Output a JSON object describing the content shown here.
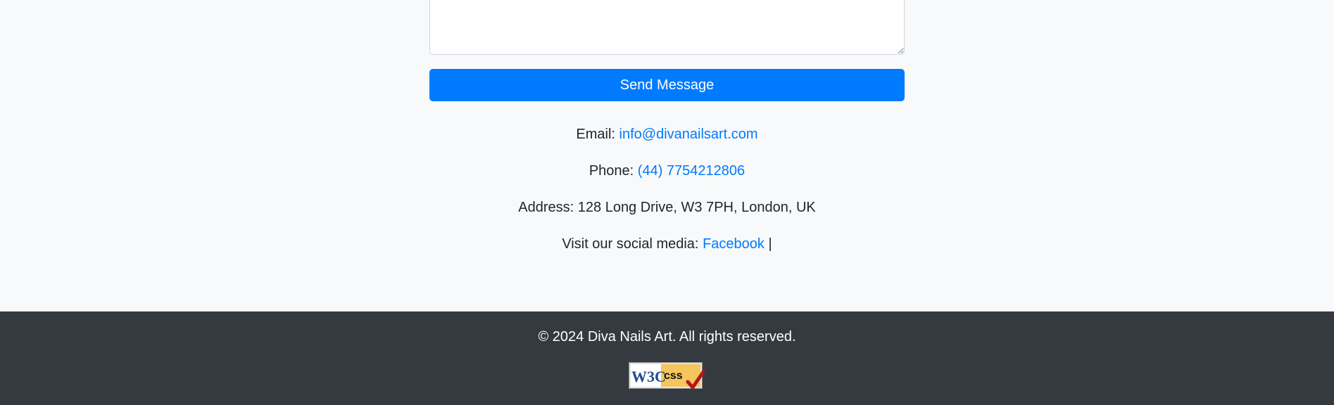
{
  "form": {
    "message_value": "",
    "send_label": "Send Message"
  },
  "contact": {
    "email_label": "Email:",
    "email_value": "info@divanailsart.com",
    "phone_label": "Phone:",
    "phone_value": "(44) 7754212806",
    "address_label": "Address:",
    "address_value": "128 Long Drive, W3 7PH, London, UK",
    "social_label": "Visit our social media:",
    "social_links": [
      "Facebook"
    ],
    "social_separator": "|"
  },
  "footer": {
    "copyright": "© 2024 Diva Nails Art. All rights reserved.",
    "badge_w3c_text": "W3C",
    "badge_css_text": "css"
  },
  "colors": {
    "primary": "#007bff",
    "footer_bg": "#343a40",
    "page_bg": "#f8f9fa",
    "badge_yellow": "#f4c65c",
    "check_red": "#b3171a"
  }
}
